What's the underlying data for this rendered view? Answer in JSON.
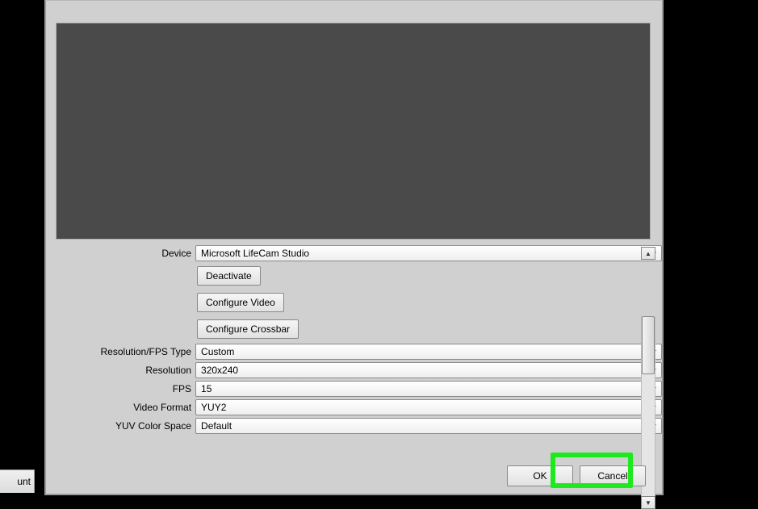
{
  "labels": {
    "device": "Device",
    "resolution_fps_type": "Resolution/FPS Type",
    "resolution": "Resolution",
    "fps": "FPS",
    "video_format": "Video Format",
    "yuv_color_space": "YUV Color Space"
  },
  "values": {
    "device": "Microsoft LifeCam Studio",
    "resolution_fps_type": "Custom",
    "resolution": "320x240",
    "fps": "15",
    "video_format": "YUY2",
    "yuv_color_space": "Default"
  },
  "buttons": {
    "deactivate": "Deactivate",
    "configure_video": "Configure Video",
    "configure_crossbar": "Configure Crossbar",
    "ok": "OK",
    "cancel": "Cancel"
  },
  "partial_text": "unt"
}
